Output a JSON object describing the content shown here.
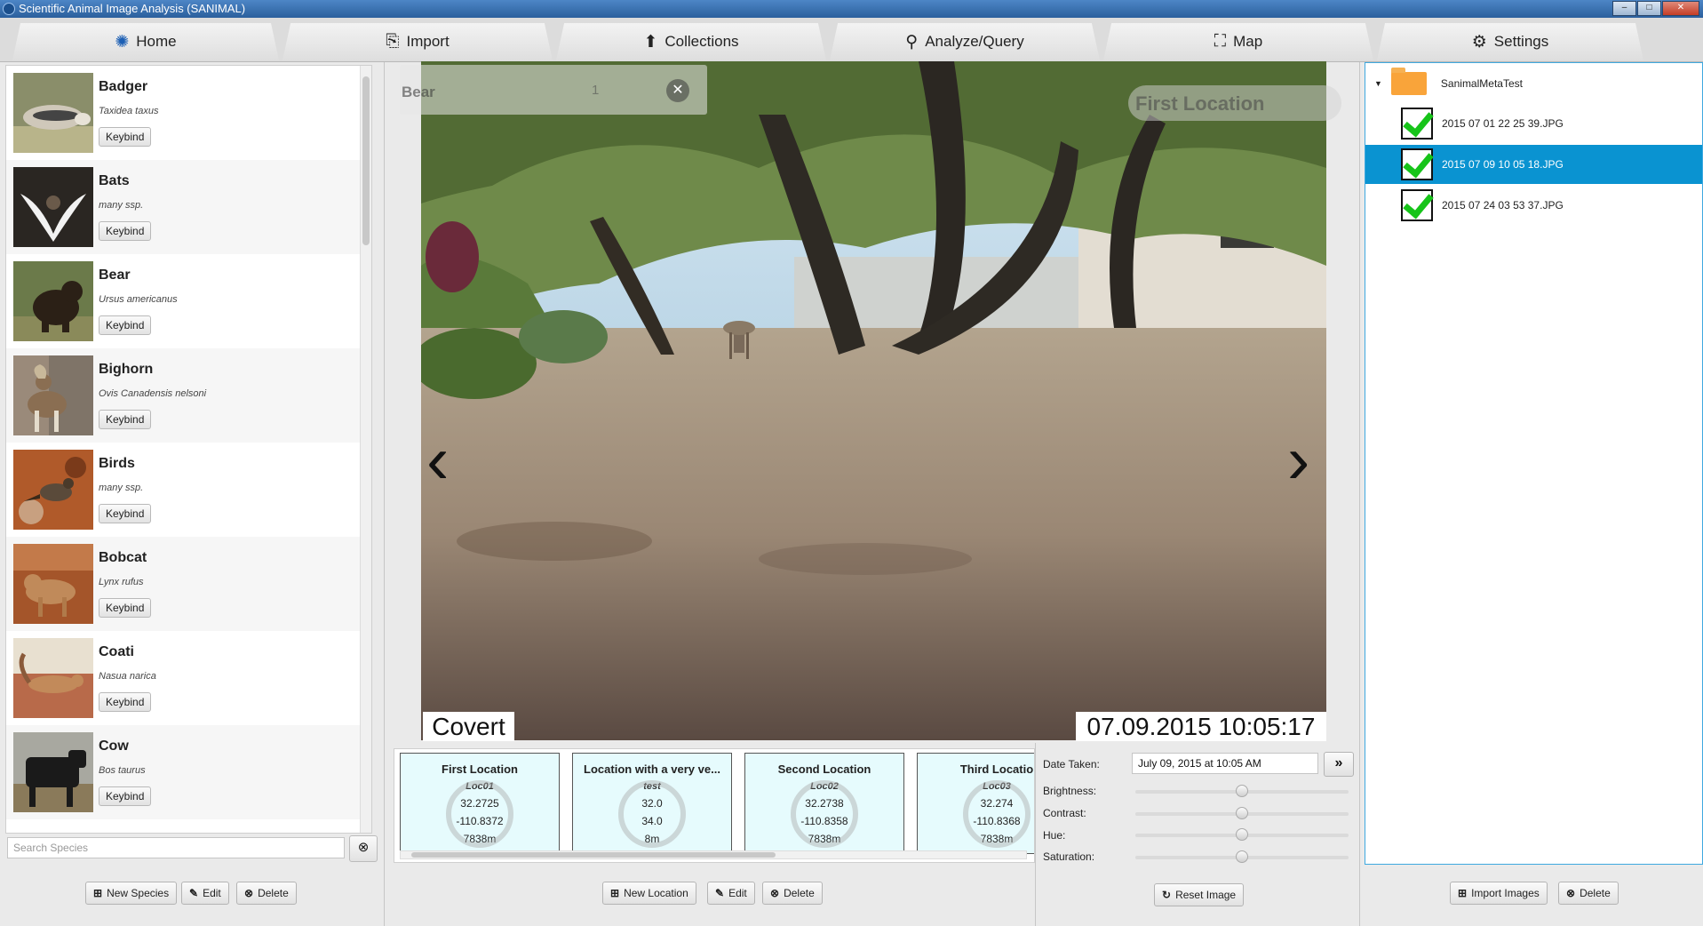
{
  "window": {
    "title": "Scientific Animal Image Analysis (SANIMAL)",
    "minimize": "–",
    "maximize": "□",
    "close": "✕"
  },
  "tabs": [
    {
      "label": "Home",
      "icon": "home-icon"
    },
    {
      "label": "Import",
      "icon": "import-icon"
    },
    {
      "label": "Collections",
      "icon": "collections-icon"
    },
    {
      "label": "Analyze/Query",
      "icon": "analyze-icon"
    },
    {
      "label": "Map",
      "icon": "map-icon"
    },
    {
      "label": "Settings",
      "icon": "gear-icon"
    }
  ],
  "species": {
    "keybind_label": "Keybind",
    "items": [
      {
        "name": "Badger",
        "scientific": "Taxidea taxus"
      },
      {
        "name": "Bats",
        "scientific": "many ssp."
      },
      {
        "name": "Bear",
        "scientific": "Ursus americanus"
      },
      {
        "name": "Bighorn",
        "scientific": "Ovis Canadensis nelsoni"
      },
      {
        "name": "Birds",
        "scientific": "many ssp."
      },
      {
        "name": "Bobcat",
        "scientific": "Lynx rufus"
      },
      {
        "name": "Coati",
        "scientific": "Nasua narica"
      },
      {
        "name": "Cow",
        "scientific": "Bos taurus"
      }
    ],
    "search_placeholder": "Search Species",
    "new_label": "New Species",
    "edit_label": "Edit",
    "delete_label": "Delete"
  },
  "viewer": {
    "species_tag": "Bear",
    "species_count": "1",
    "location_tag": "First Location",
    "brand": "Covert",
    "timestamp": "07.09.2015  10:05:17"
  },
  "locations": {
    "cards": [
      {
        "name": "First Location",
        "id": "Loc01",
        "lat": "32.2725",
        "lng": "-110.8372",
        "elev": "7838m"
      },
      {
        "name": "Location with a very ve...",
        "id": "test",
        "lat": "32.0",
        "lng": "34.0",
        "elev": "8m"
      },
      {
        "name": "Second Location",
        "id": "Loc02",
        "lat": "32.2738",
        "lng": "-110.8358",
        "elev": "7838m"
      },
      {
        "name": "Third Locatio",
        "id": "Loc03",
        "lat": "32.274",
        "lng": "-110.8368",
        "elev": "7838m"
      }
    ],
    "new_label": "New Location",
    "edit_label": "Edit",
    "delete_label": "Delete"
  },
  "adjust": {
    "date_label": "Date Taken:",
    "date_value": "July 09, 2015 at 10:05 AM",
    "brightness_label": "Brightness:",
    "contrast_label": "Contrast:",
    "hue_label": "Hue:",
    "saturation_label": "Saturation:",
    "reset_label": "Reset Image"
  },
  "files": {
    "folder": "SanimalMetaTest",
    "items": [
      {
        "name": "2015 07 01 22 25 39.JPG",
        "selected": false
      },
      {
        "name": "2015 07 09 10 05 18.JPG",
        "selected": true
      },
      {
        "name": "2015 07 24 03 53 37.JPG",
        "selected": false
      }
    ],
    "import_label": "Import Images",
    "delete_label": "Delete"
  }
}
